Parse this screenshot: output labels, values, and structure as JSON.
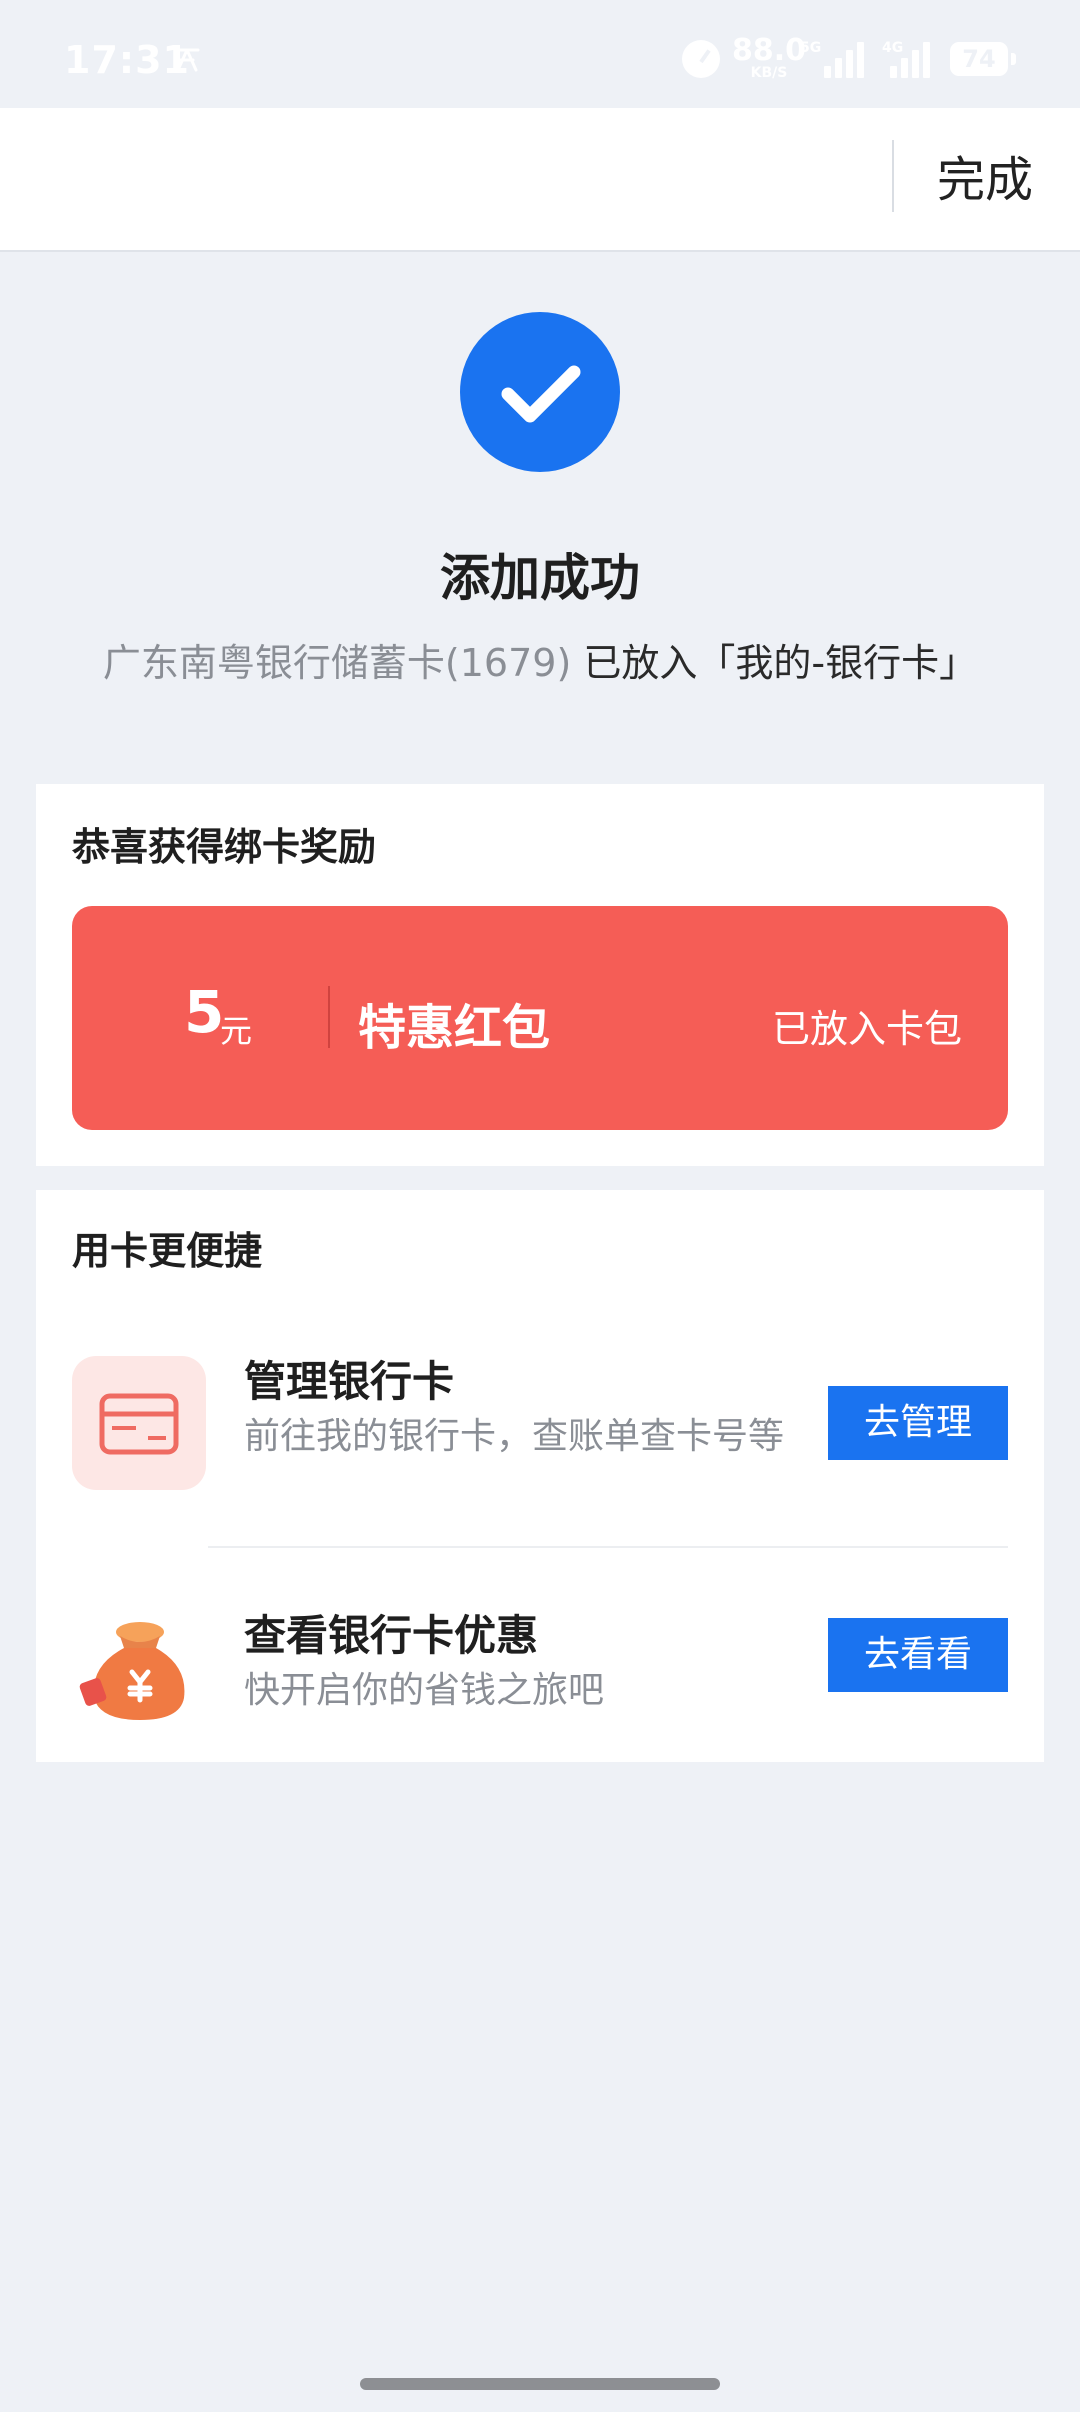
{
  "status_bar": {
    "time": "17:31",
    "network_speed": "88.0",
    "network_speed_unit": "KB/S",
    "signal_tag_1": "5G",
    "signal_tag_2": "4G",
    "battery": "74"
  },
  "nav": {
    "done_label": "完成"
  },
  "success": {
    "title": "添加成功",
    "card_name": "广东南粤银行储蓄卡(1679)",
    "destination": " 已放入「我的-银行卡」"
  },
  "reward": {
    "title": "恭喜获得绑卡奖励",
    "amount": "5",
    "unit": "元",
    "name": "特惠红包",
    "status": "已放入卡包"
  },
  "convenience": {
    "title": "用卡更便捷",
    "items": [
      {
        "title": "管理银行卡",
        "subtitle": "前往我的银行卡，查账单查卡号等",
        "button": "去管理",
        "icon": "bank-card-icon"
      },
      {
        "title": "查看银行卡优惠",
        "subtitle": "快开启你的省钱之旅吧",
        "button": "去看看",
        "icon": "money-bag-icon"
      }
    ]
  },
  "colors": {
    "accent_blue": "#1a73f0",
    "reward_red": "#f55d56",
    "background": "#eef1f6"
  }
}
